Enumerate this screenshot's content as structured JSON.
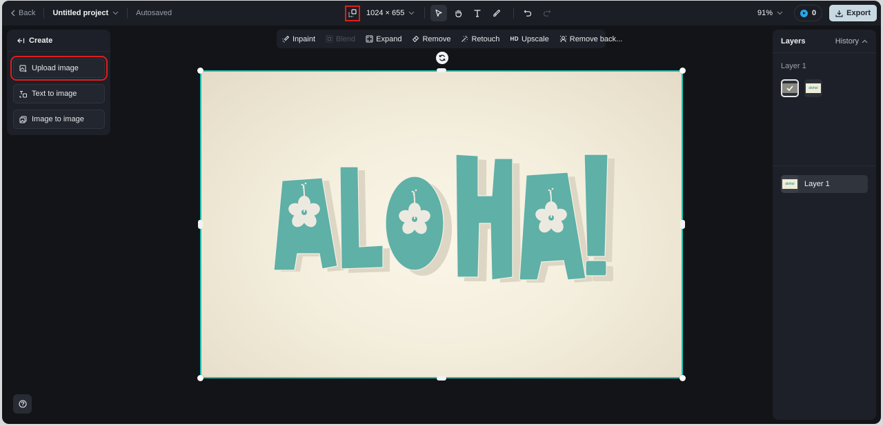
{
  "topbar": {
    "back_label": "Back",
    "project_name": "Untitled project",
    "save_status": "Autosaved",
    "canvas_size": "1024 × 655",
    "tools": [
      {
        "name": "select",
        "icon": "cursor-arrow-icon",
        "active": true
      },
      {
        "name": "hand",
        "icon": "hand-icon",
        "active": false
      },
      {
        "name": "text",
        "icon": "text-icon",
        "active": false
      },
      {
        "name": "brush",
        "icon": "brush-icon",
        "active": false
      }
    ],
    "undo_icon": "undo-icon",
    "redo_icon": "redo-icon",
    "zoom_level": "91%",
    "credits": "0",
    "export_label": "Export"
  },
  "left_panel": {
    "header": "Create",
    "items": [
      {
        "label": "Upload image",
        "icon": "upload-image-icon",
        "highlighted": true
      },
      {
        "label": "Text to image",
        "icon": "text-to-image-icon",
        "highlighted": false
      },
      {
        "label": "Image to image",
        "icon": "image-to-image-icon",
        "highlighted": false
      }
    ],
    "help_icon": "help-icon"
  },
  "edit_toolbar": {
    "items": [
      {
        "label": "Inpaint",
        "icon": "inpaint-icon",
        "enabled": true
      },
      {
        "label": "Blend",
        "icon": "blend-icon",
        "enabled": false
      },
      {
        "label": "Expand",
        "icon": "expand-icon",
        "enabled": true
      },
      {
        "label": "Remove",
        "icon": "eraser-icon",
        "enabled": true
      },
      {
        "label": "Retouch",
        "icon": "magic-wand-icon",
        "enabled": true
      },
      {
        "label": "Upscale",
        "icon": "hd-icon",
        "icon_text": "HD",
        "enabled": true
      },
      {
        "label": "Remove back...",
        "icon": "remove-background-icon",
        "enabled": true
      }
    ]
  },
  "canvas": {
    "image_text": "ALOHA!",
    "accent_color": "#1fc2b4",
    "letter_color": "#5fb0a7"
  },
  "right_panel": {
    "title": "Layers",
    "history_label": "History",
    "group_label": "Layer 1",
    "thumb_text": "aloha!",
    "layers": [
      {
        "name": "Layer 1"
      }
    ]
  },
  "colors": {
    "highlight_red": "#e01e1e",
    "selection_teal": "#1fc2b4",
    "credit_blue": "#2aa7e8",
    "export_bg": "#c9d9e2"
  }
}
